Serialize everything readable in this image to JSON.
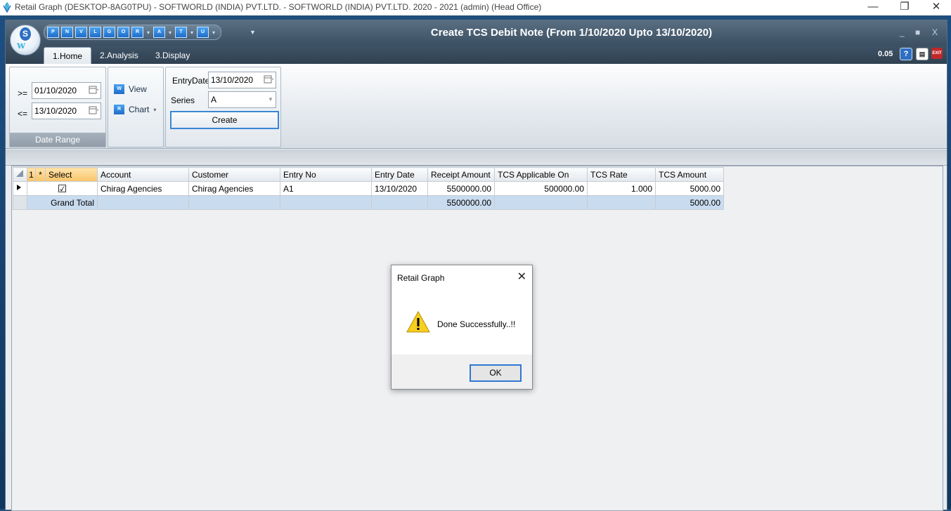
{
  "os_window": {
    "title": "Retail Graph (DESKTOP-8AG0TPU) - SOFTWORLD (INDIA) PVT.LTD. - SOFTWORLD (INDIA) PVT.LTD.  2020 - 2021 (admin) (Head Office)",
    "minimize": "—",
    "restore": "❐",
    "close": "✕"
  },
  "app": {
    "window_title": "Create TCS Debit Note (From 1/10/2020 Upto 13/10/2020)",
    "quick_access": [
      "P",
      "N",
      "V",
      "L",
      "G",
      "O",
      "R",
      "A",
      "T",
      "U"
    ],
    "inner_controls": [
      "_",
      "■",
      "X"
    ],
    "tabs": [
      "1.Home",
      "2.Analysis",
      "3.Display"
    ],
    "zoom": "0.05",
    "help_icon": "?",
    "exit_icon": "EXIT"
  },
  "ribbon": {
    "date_range": {
      "caption": "Date Range",
      "from_label": ">=",
      "from_value": "01/10/2020",
      "to_label": "<=",
      "to_value": "13/10/2020"
    },
    "view_group": {
      "view_label": "View",
      "chart_label": "Chart",
      "view_icon": "W",
      "chart_icon": "R"
    },
    "create_group": {
      "entry_date_label": "EntryDate",
      "entry_date_value": "13/10/2020",
      "series_label": "Series",
      "series_value": "A",
      "create_label": "Create"
    }
  },
  "grid": {
    "header_corner": "1",
    "header_star": "*",
    "columns": [
      "Select",
      "Account",
      "Customer",
      "Entry No",
      "Entry Date",
      "Receipt Amount",
      "TCS Applicable On",
      "TCS Rate",
      "TCS Amount"
    ],
    "rows": [
      {
        "selected": true,
        "check": "☑",
        "account": "Chirag Agencies",
        "customer": "Chirag Agencies",
        "entry_no": "A1",
        "entry_date": "13/10/2020",
        "receipt_amount": "5500000.00",
        "tcs_applicable_on": "500000.00",
        "tcs_rate": "1.000",
        "tcs_amount": "5000.00"
      }
    ],
    "total": {
      "label": "Grand Total",
      "receipt_amount": "5500000.00",
      "tcs_amount": "5000.00"
    }
  },
  "dialog": {
    "title": "Retail Graph",
    "close": "✕",
    "message": "Done Successfully..!!",
    "ok_label": "OK"
  },
  "colors": {
    "accent": "#2f78d2",
    "selected_header": "#f9c56a",
    "total_row": "#c9dbef"
  }
}
